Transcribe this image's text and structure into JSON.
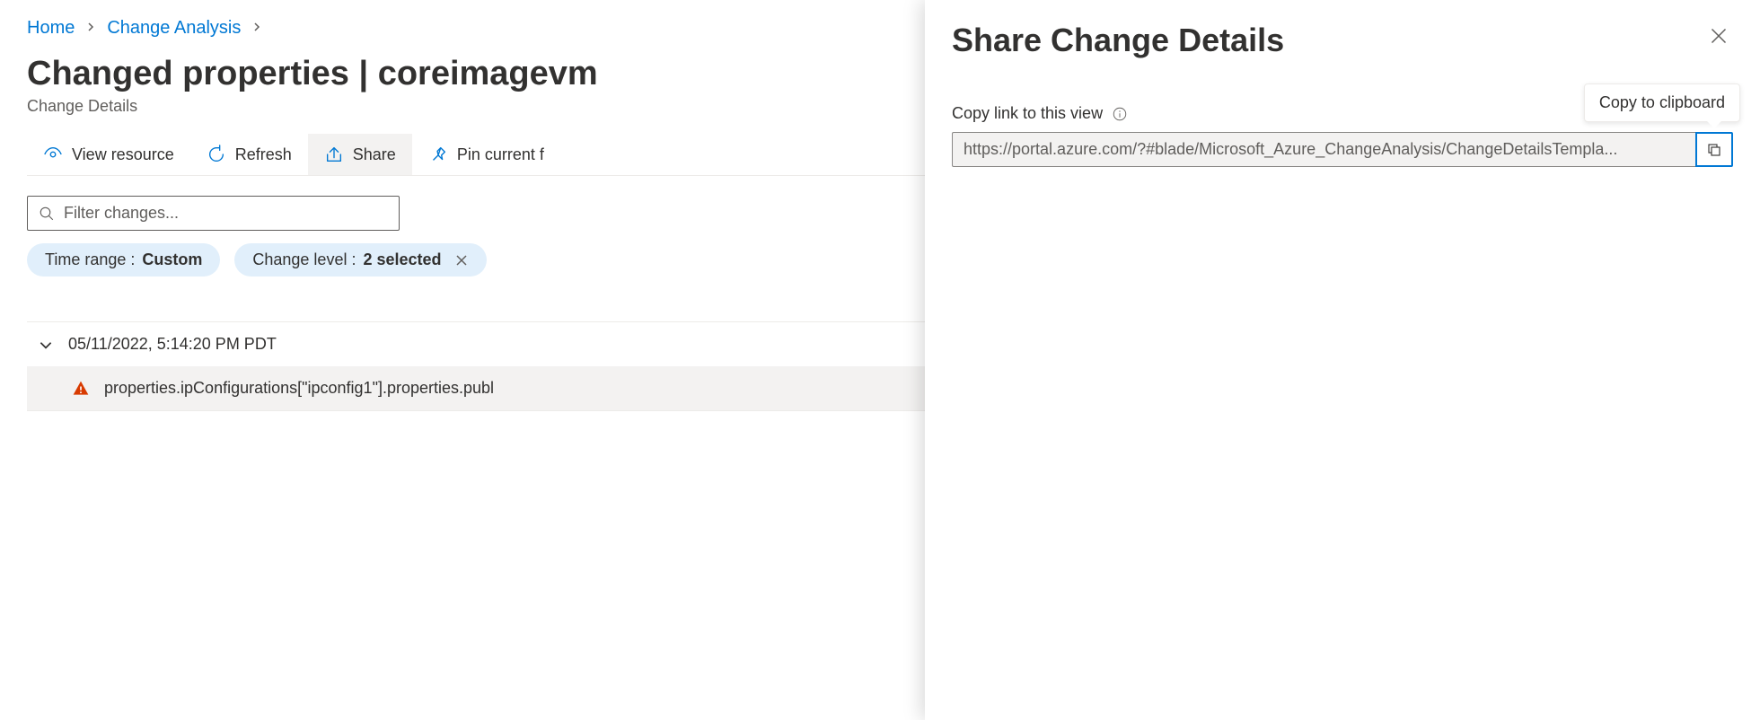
{
  "breadcrumb": {
    "home": "Home",
    "changeAnalysis": "Change Analysis"
  },
  "page": {
    "title": "Changed properties | coreimagevm",
    "subtitle": "Change Details"
  },
  "toolbar": {
    "viewResource": "View resource",
    "refresh": "Refresh",
    "share": "Share",
    "pinCurrent": "Pin current f"
  },
  "filter": {
    "placeholder": "Filter changes..."
  },
  "pills": {
    "timeRange": {
      "label": "Time range : ",
      "value": "Custom"
    },
    "changeLevel": {
      "label": "Change level : ",
      "value": "2 selected"
    }
  },
  "changes": {
    "groupTimestamp": "05/11/2022, 5:14:20 PM PDT",
    "row1": "properties.ipConfigurations[\"ipconfig1\"].properties.publ"
  },
  "panel": {
    "title": "Share Change Details",
    "fieldLabel": "Copy link to this view",
    "url": "https://portal.azure.com/?#blade/Microsoft_Azure_ChangeAnalysis/ChangeDetailsTempla...",
    "tooltip": "Copy to clipboard"
  }
}
